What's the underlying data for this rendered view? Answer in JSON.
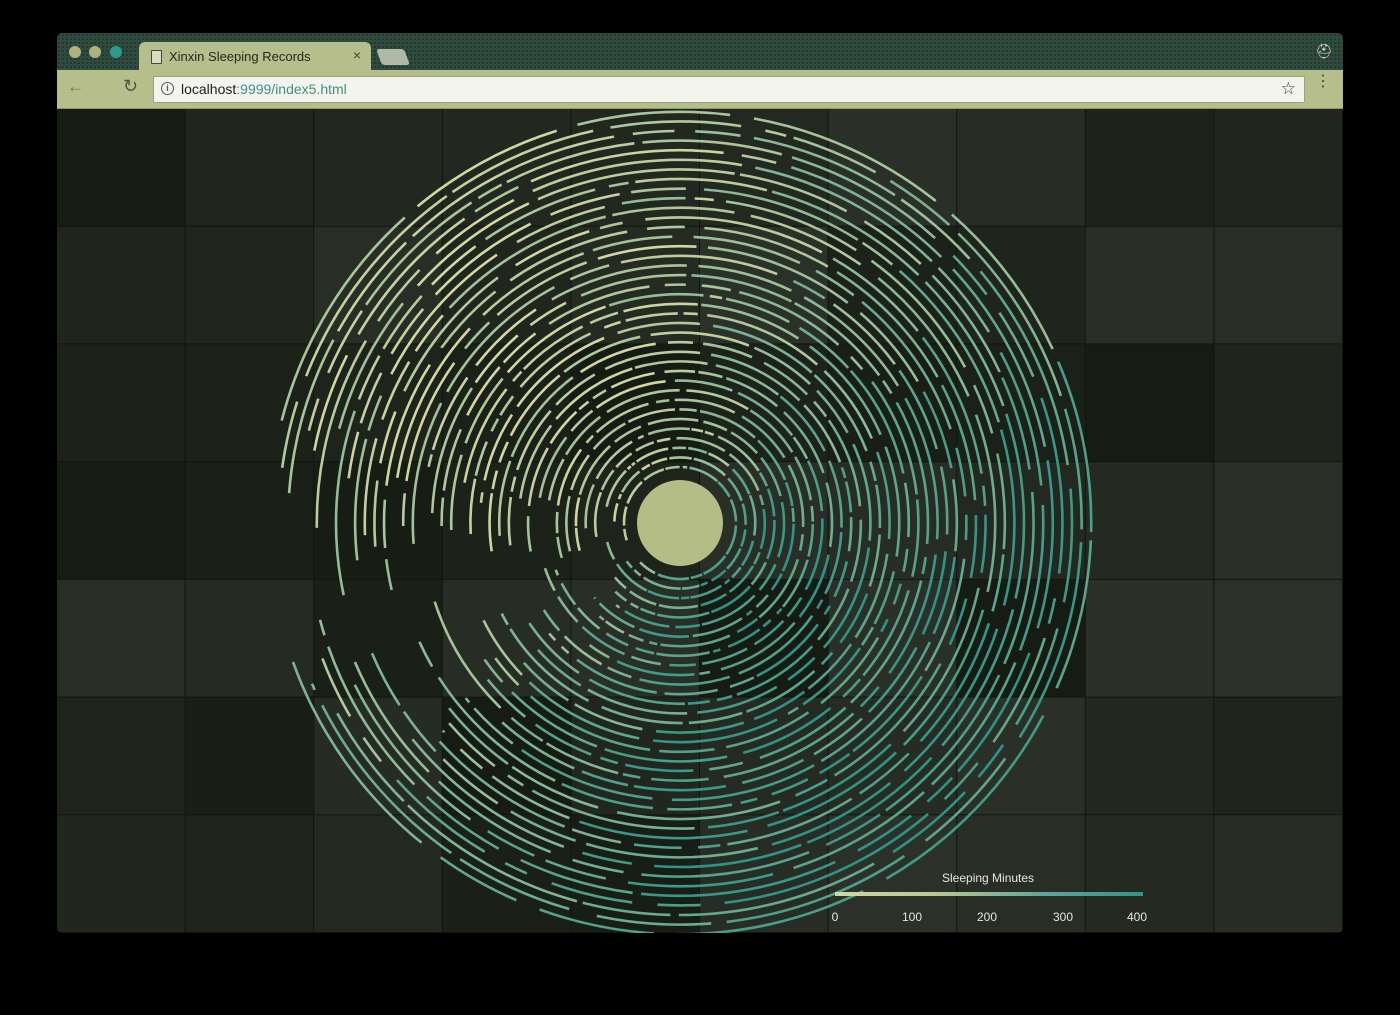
{
  "browser": {
    "tab_title": "Xinxin Sleeping Records",
    "tab_close": "×",
    "url_host": "localhost",
    "url_rest": ":9999/index5.html",
    "back_glyph": "←",
    "reload_glyph": "↻",
    "info_glyph": "i",
    "star_glyph": "☆",
    "menu_glyph": "⋮",
    "profile_glyph": "⛑"
  },
  "colors": {
    "low": "#d2d7a0",
    "high": "#2f9488",
    "center": "#b3bd85",
    "background": "#121410"
  },
  "chart_data": {
    "type": "radial-arc",
    "legend": {
      "title": "Sleeping Minutes",
      "ticks": [
        "0",
        "100",
        "200",
        "300",
        "400"
      ],
      "domain": [
        0,
        400
      ]
    },
    "ring_count": 38
  }
}
